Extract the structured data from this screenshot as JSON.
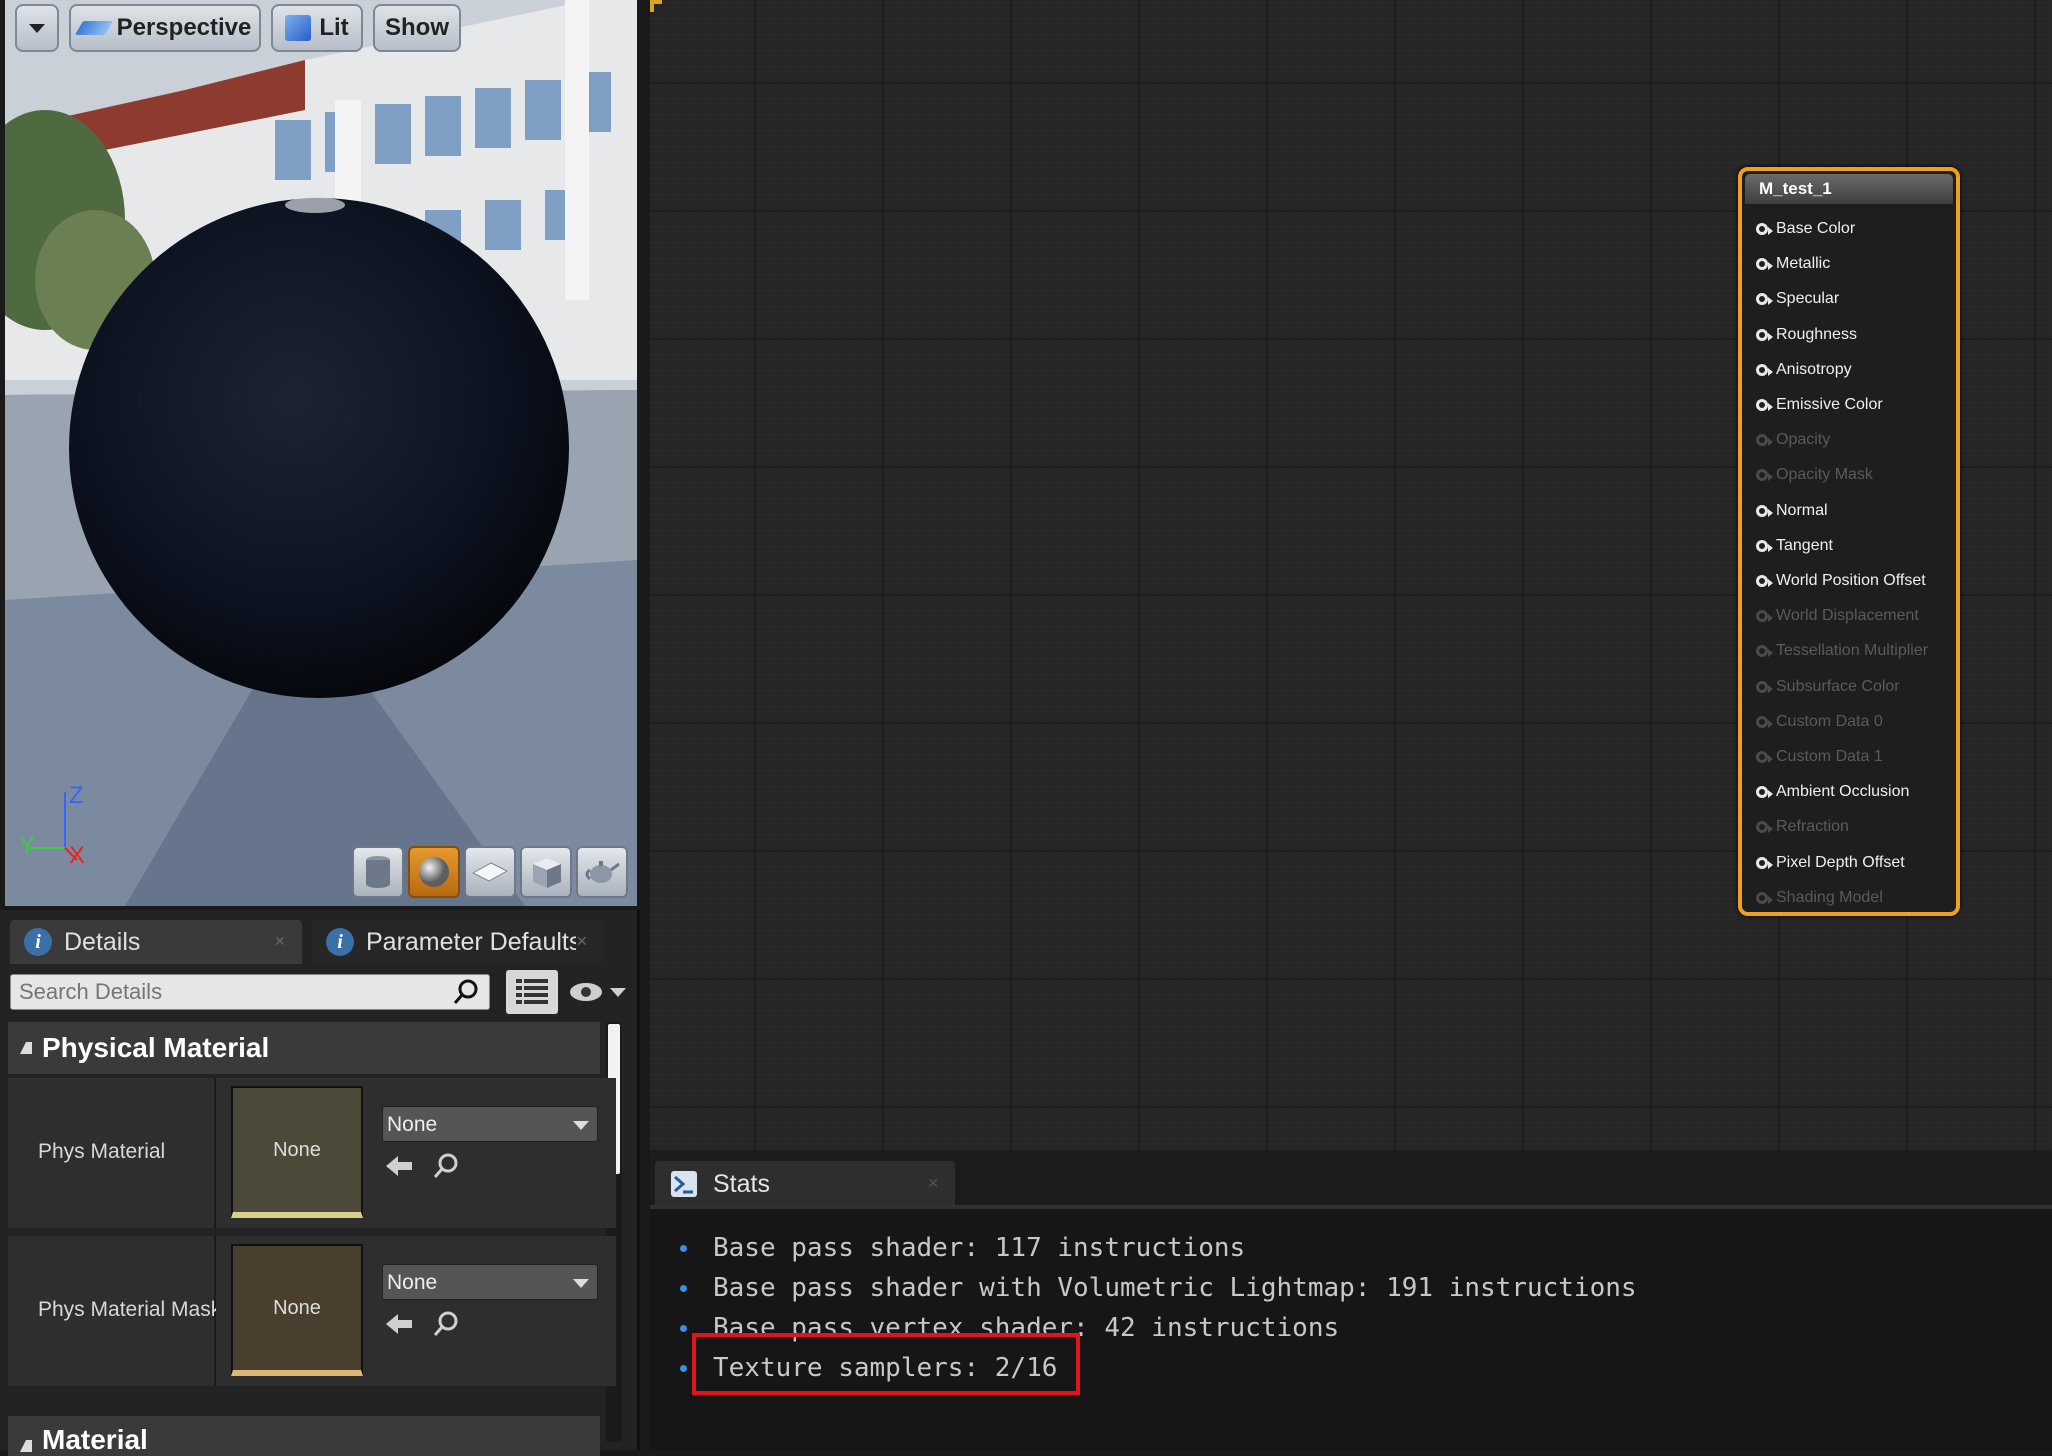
{
  "viewport": {
    "dropdown_icon": "chevron-down-icon",
    "perspective_label": "Perspective",
    "lit_label": "Lit",
    "show_label": "Show",
    "axis": {
      "z": "Z",
      "y": "Y",
      "x": "X"
    },
    "preview_tools": [
      "cylinder-icon",
      "sphere-icon",
      "plane-icon",
      "cube-icon",
      "teapot-icon"
    ],
    "active_tool": "sphere-icon"
  },
  "details": {
    "tabs": [
      {
        "label": "Details"
      },
      {
        "label": "Parameter Defaults"
      }
    ],
    "search_placeholder": "Search Details",
    "sections": {
      "physical_material": "Physical Material",
      "material": "Material"
    },
    "rows": [
      {
        "label": "Phys Material",
        "thumb": "None",
        "value": "None"
      },
      {
        "label": "Phys Material Mask",
        "thumb": "None",
        "value": "None"
      }
    ]
  },
  "node": {
    "title": "M_test_1",
    "pins": [
      {
        "label": "Base Color",
        "enabled": true
      },
      {
        "label": "Metallic",
        "enabled": true
      },
      {
        "label": "Specular",
        "enabled": true
      },
      {
        "label": "Roughness",
        "enabled": true
      },
      {
        "label": "Anisotropy",
        "enabled": true
      },
      {
        "label": "Emissive Color",
        "enabled": true
      },
      {
        "label": "Opacity",
        "enabled": false
      },
      {
        "label": "Opacity Mask",
        "enabled": false
      },
      {
        "label": "Normal",
        "enabled": true
      },
      {
        "label": "Tangent",
        "enabled": true
      },
      {
        "label": "World Position Offset",
        "enabled": true
      },
      {
        "label": "World Displacement",
        "enabled": false
      },
      {
        "label": "Tessellation Multiplier",
        "enabled": false
      },
      {
        "label": "Subsurface Color",
        "enabled": false
      },
      {
        "label": "Custom Data 0",
        "enabled": false
      },
      {
        "label": "Custom Data 1",
        "enabled": false
      },
      {
        "label": "Ambient Occlusion",
        "enabled": true
      },
      {
        "label": "Refraction",
        "enabled": false
      },
      {
        "label": "Pixel Depth Offset",
        "enabled": true
      },
      {
        "label": "Shading Model",
        "enabled": false
      }
    ]
  },
  "stats": {
    "tab_label": "Stats",
    "lines": [
      "Base pass shader: 117 instructions",
      "Base pass shader with Volumetric Lightmap: 191 instructions",
      "Base pass vertex shader: 42 instructions",
      "Texture samplers: 2/16"
    ],
    "highlight_color": "#e0141a"
  },
  "colors": {
    "node_border": "#f0a020",
    "stat_bullet": "#3a8de0"
  }
}
